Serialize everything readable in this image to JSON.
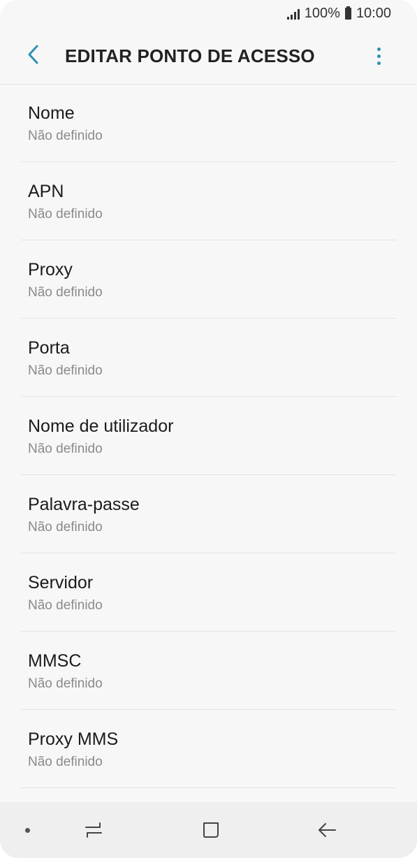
{
  "status_bar": {
    "battery_percent": "100%",
    "time": "10:00",
    "icons": [
      "signal-icon",
      "battery-icon"
    ]
  },
  "app_bar": {
    "title": "EDITAR PONTO DE ACESSO",
    "back_icon": "chevron-left-icon",
    "more_icon": "more-vertical-icon",
    "accent_color": "#2f8fb5"
  },
  "settings": [
    {
      "label": "Nome",
      "value": "Não definido"
    },
    {
      "label": "APN",
      "value": "Não definido"
    },
    {
      "label": "Proxy",
      "value": "Não definido"
    },
    {
      "label": "Porta",
      "value": "Não definido"
    },
    {
      "label": "Nome de utilizador",
      "value": "Não definido"
    },
    {
      "label": "Palavra-passe",
      "value": "Não definido"
    },
    {
      "label": "Servidor",
      "value": "Não definido"
    },
    {
      "label": "MMSC",
      "value": "Não definido"
    },
    {
      "label": "Proxy MMS",
      "value": "Não definido"
    }
  ],
  "nav_bar": {
    "icons": [
      "nav-dot-icon",
      "recent-apps-icon",
      "home-icon",
      "back-arrow-icon"
    ]
  }
}
